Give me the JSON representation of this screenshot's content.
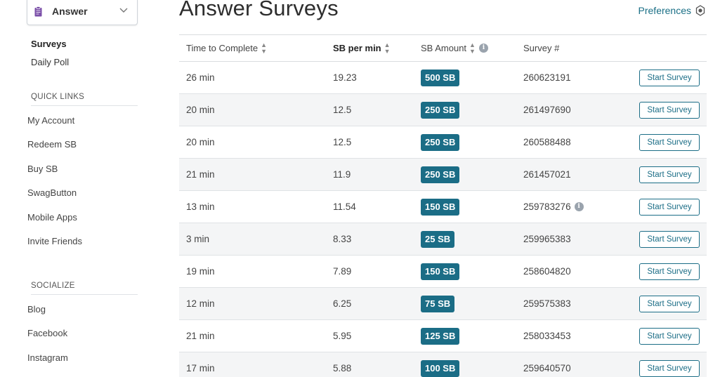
{
  "sidebar": {
    "dropdown_label": "Answer",
    "sub_items": [
      "Surveys",
      "Daily Poll"
    ],
    "quick_links_heading": "QUICK LINKS",
    "quick_links": [
      "My Account",
      "Redeem SB",
      "Buy SB",
      "SwagButton",
      "Mobile Apps",
      "Invite Friends"
    ],
    "socialize_heading": "SOCIALIZE",
    "social_links": [
      "Blog",
      "Facebook",
      "Instagram"
    ]
  },
  "main": {
    "title": "Answer Surveys",
    "preferences_label": "Preferences",
    "columns": [
      "Time to Complete",
      "SB per min",
      "SB Amount",
      "Survey #"
    ],
    "start_label": "Start Survey",
    "rows": [
      {
        "time": "26 min",
        "rate": "19.23",
        "amount": "500 SB",
        "survey": "260623191",
        "info": false
      },
      {
        "time": "20 min",
        "rate": "12.5",
        "amount": "250 SB",
        "survey": "261497690",
        "info": false
      },
      {
        "time": "20 min",
        "rate": "12.5",
        "amount": "250 SB",
        "survey": "260588488",
        "info": false
      },
      {
        "time": "21 min",
        "rate": "11.9",
        "amount": "250 SB",
        "survey": "261457021",
        "info": false
      },
      {
        "time": "13 min",
        "rate": "11.54",
        "amount": "150 SB",
        "survey": "259783276",
        "info": true
      },
      {
        "time": "3 min",
        "rate": "8.33",
        "amount": "25 SB",
        "survey": "259965383",
        "info": false
      },
      {
        "time": "19 min",
        "rate": "7.89",
        "amount": "150 SB",
        "survey": "258604820",
        "info": false
      },
      {
        "time": "12 min",
        "rate": "6.25",
        "amount": "75 SB",
        "survey": "259575383",
        "info": false
      },
      {
        "time": "21 min",
        "rate": "5.95",
        "amount": "125 SB",
        "survey": "258033453",
        "info": false
      },
      {
        "time": "17 min",
        "rate": "5.88",
        "amount": "100 SB",
        "survey": "259640570",
        "info": false
      }
    ]
  },
  "colors": {
    "accent": "#1b6d86",
    "clipboard": "#7b4fa8"
  },
  "icons": {
    "dropdown": "clipboard-icon",
    "dropdown_chevron": "chevron-down-icon",
    "preferences": "gear-icon",
    "sort": "sort-icon",
    "info": "info-icon"
  }
}
